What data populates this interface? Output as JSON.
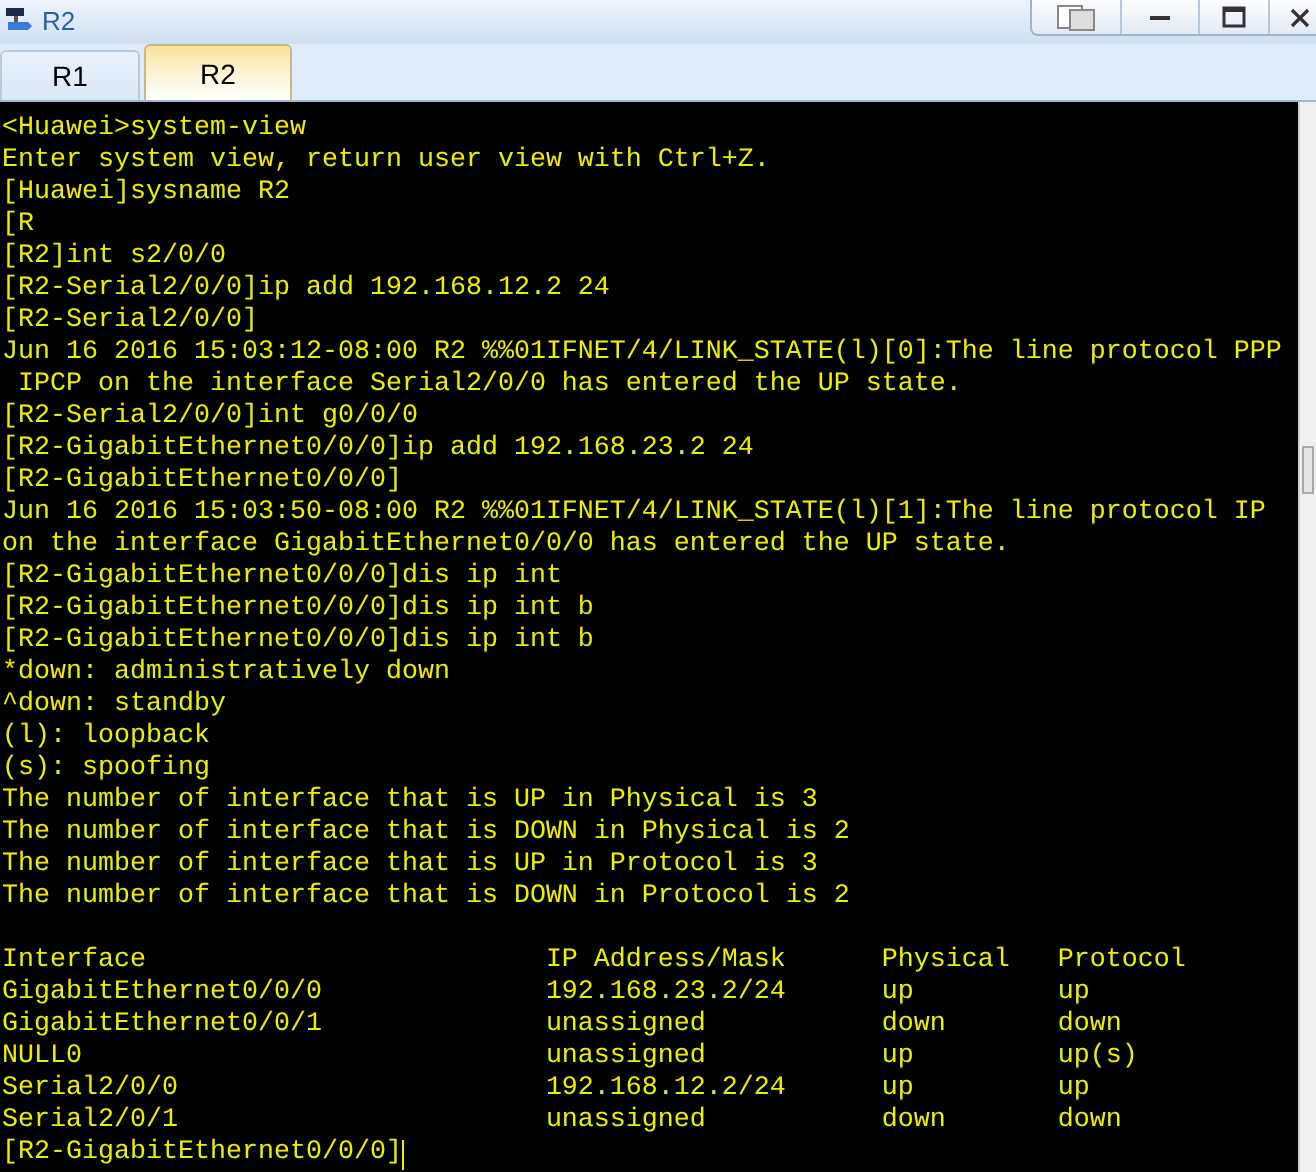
{
  "window": {
    "title": "R2"
  },
  "tabs": [
    {
      "label": "R1",
      "selected": false
    },
    {
      "label": "R2",
      "selected": true
    }
  ],
  "terminal": {
    "lines": [
      "<Huawei>system-view",
      "Enter system view, return user view with Ctrl+Z.",
      "[Huawei]sysname R2",
      "[R",
      "[R2]int s2/0/0",
      "[R2-Serial2/0/0]ip add 192.168.12.2 24",
      "[R2-Serial2/0/0]",
      "Jun 16 2016 15:03:12-08:00 R2 %%01IFNET/4/LINK_STATE(l)[0]:The line protocol PPP",
      " IPCP on the interface Serial2/0/0 has entered the UP state.",
      "[R2-Serial2/0/0]int g0/0/0",
      "[R2-GigabitEthernet0/0/0]ip add 192.168.23.2 24",
      "[R2-GigabitEthernet0/0/0]",
      "Jun 16 2016 15:03:50-08:00 R2 %%01IFNET/4/LINK_STATE(l)[1]:The line protocol IP",
      "on the interface GigabitEthernet0/0/0 has entered the UP state.",
      "[R2-GigabitEthernet0/0/0]dis ip int",
      "[R2-GigabitEthernet0/0/0]dis ip int b",
      "[R2-GigabitEthernet0/0/0]dis ip int b",
      "*down: administratively down",
      "^down: standby",
      "(l): loopback",
      "(s): spoofing",
      "The number of interface that is UP in Physical is 3",
      "The number of interface that is DOWN in Physical is 2",
      "The number of interface that is UP in Protocol is 3",
      "The number of interface that is DOWN in Protocol is 2"
    ],
    "table": {
      "columns": [
        "Interface",
        "IP Address/Mask",
        "Physical",
        "Protocol"
      ],
      "rows": [
        [
          "GigabitEthernet0/0/0",
          "192.168.23.2/24",
          "up",
          "up"
        ],
        [
          "GigabitEthernet0/0/1",
          "unassigned",
          "down",
          "down"
        ],
        [
          "NULL0",
          "unassigned",
          "up",
          "up(s)"
        ],
        [
          "Serial2/0/0",
          "192.168.12.2/24",
          "up",
          "up"
        ],
        [
          "Serial2/0/1",
          "unassigned",
          "down",
          "down"
        ]
      ]
    },
    "prompt": "[R2-GigabitEthernet0/0/0]"
  }
}
